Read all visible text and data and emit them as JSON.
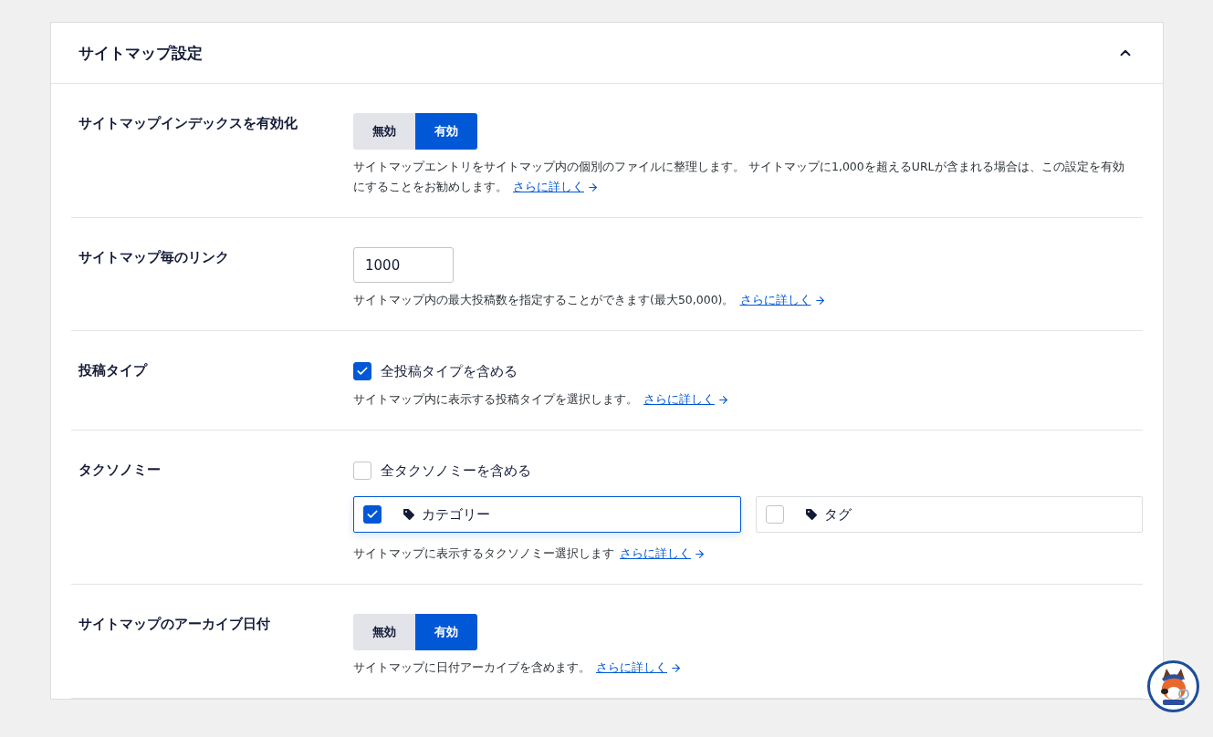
{
  "panel": {
    "title": "サイトマップ設定",
    "expanded": true
  },
  "rows": [
    {
      "kind": "toggle",
      "label": "サイトマップインデックスを有効化",
      "options": [
        {
          "label": "無効",
          "selected": false
        },
        {
          "label": "有効",
          "selected": true
        }
      ],
      "description": "サイトマップエントリをサイトマップ内の個別のファイルに整理します。 サイトマップに1,000を超えるURLが含まれる場合は、この設定を有効にすることをお勧めします。",
      "link": "さらに詳しく"
    },
    {
      "kind": "number",
      "label": "サイトマップ毎のリンク",
      "value": "1000",
      "description": "サイトマップ内の最大投稿数を指定することができます(最大50,000)。",
      "link": "さらに詳しく"
    },
    {
      "kind": "checkbox",
      "label": "投稿タイプ",
      "checkbox": {
        "label": "全投稿タイプを含める",
        "checked": true
      },
      "description": "サイトマップ内に表示する投稿タイプを選択します。",
      "link": "さらに詳しく"
    },
    {
      "kind": "taxonomy",
      "label": "タクソノミー",
      "checkbox": {
        "label": "全タクソノミーを含める",
        "checked": false
      },
      "items": [
        {
          "label": "カテゴリー",
          "checked": true
        },
        {
          "label": "タグ",
          "checked": false
        }
      ],
      "description": "サイトマップに表示するタクソノミー選択します",
      "link": "さらに詳しく"
    },
    {
      "kind": "toggle",
      "label": "サイトマップのアーカイブ日付",
      "options": [
        {
          "label": "無効",
          "selected": false
        },
        {
          "label": "有効",
          "selected": true
        }
      ],
      "description": "サイトマップに日付アーカイブを含めます。",
      "link": "さらに詳しく"
    }
  ]
}
